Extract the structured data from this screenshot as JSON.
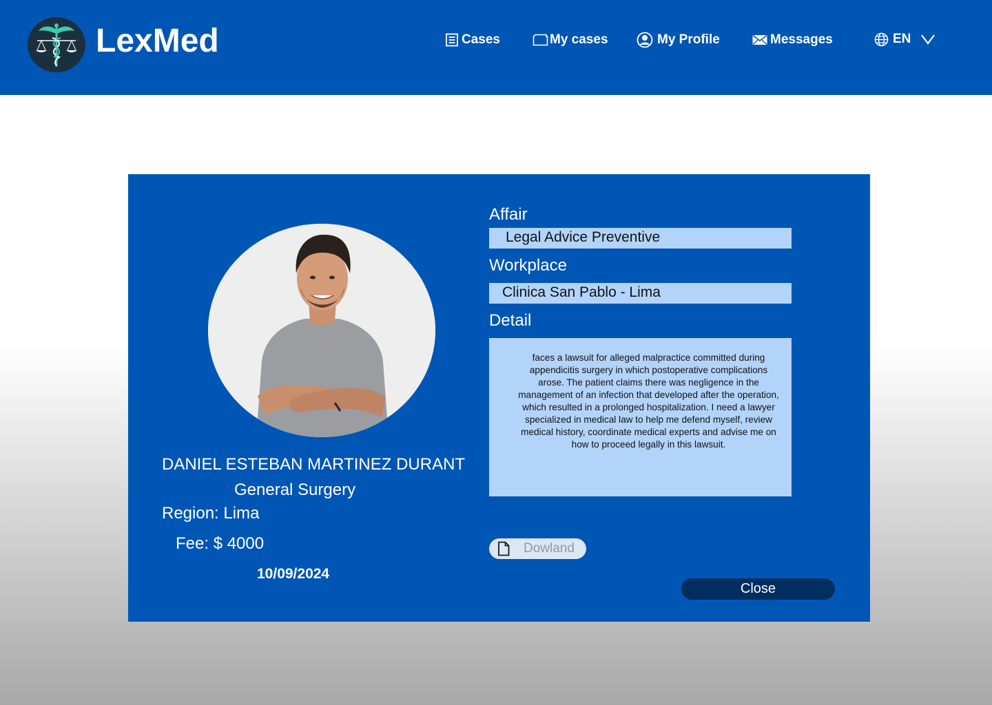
{
  "header": {
    "brand": "LexMed",
    "nav": {
      "cases": "Cases",
      "my_cases": "My cases",
      "my_profile": "My Profile",
      "messages": "Messages",
      "language": "EN"
    },
    "icons": {
      "logo": "caduceus-scales-logo-icon",
      "cases": "list-document-icon",
      "my_cases": "folder-icon",
      "my_profile": "user-circle-icon",
      "messages": "envelope-icon",
      "language": "globe-icon",
      "language_toggle": "chevron-down-icon"
    }
  },
  "case": {
    "name": "DANIEL ESTEBAN MARTINEZ DURANT",
    "specialty": "General Surgery",
    "region": "Region: Lima",
    "fee": "Fee: $ 4000",
    "date": "10/09/2024",
    "affair_label": "Affair",
    "affair_value": "Legal Advice Preventive",
    "workplace_label": "Workplace",
    "workplace_value": "Clinica San Pablo  - Lima",
    "detail_label": "Detail",
    "detail_text": "faces a lawsuit for alleged malpractice committed during appendicitis surgery in which postoperative complications arose. The patient claims there was negligence in the management of an infection that developed after the operation, which resulted in a prolonged hospitalization. I need a lawyer specialized in medical law to help me defend myself, review medical history, coordinate medical experts and advise me on how to proceed legally in this lawsuit.",
    "download_label": "Dowland",
    "close_label": "Close"
  },
  "colors": {
    "primary": "#0056b4",
    "field_bg": "#b3d4fa",
    "close_button": "#002e60",
    "logo_bg": "#1c2f3f",
    "logo_accent": "#3fc9b0"
  }
}
